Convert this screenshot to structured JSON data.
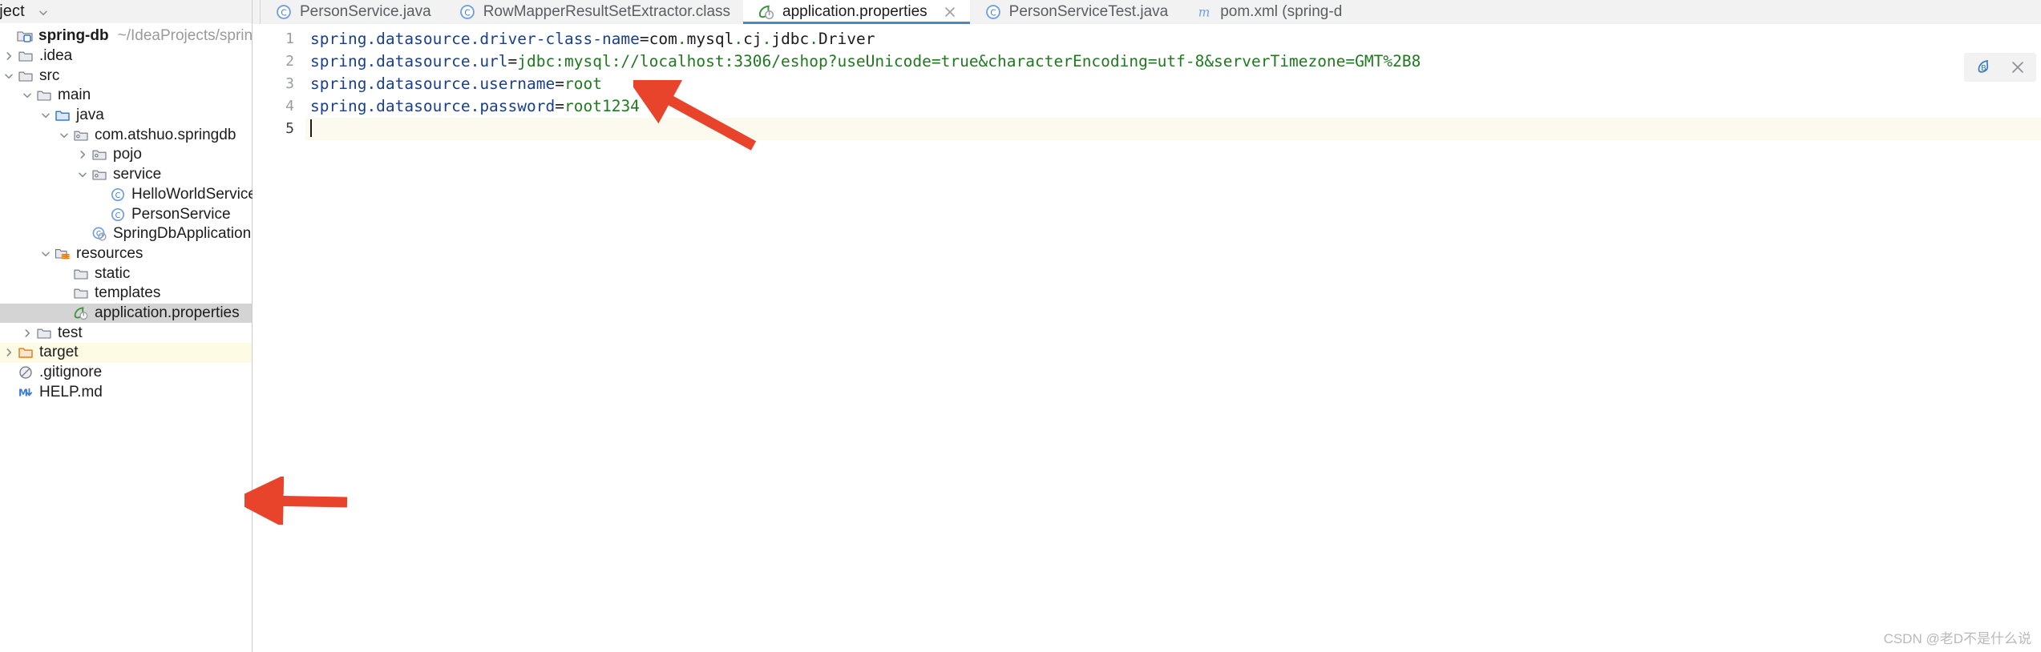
{
  "window": {
    "app": "IntelliJ IDEA",
    "watermark": "CSDN @老D不是什么说"
  },
  "project_panel": {
    "header_title": "oject",
    "header_chevron_icon": "chevron-down-icon",
    "tree": [
      {
        "label": "spring-db",
        "sublabel": "~/IdeaProjects/spring-db",
        "icon": "project-module-icon",
        "indent": 0,
        "twisty": "none",
        "bold": true,
        "state": "normal"
      },
      {
        "label": ".idea",
        "sublabel": "",
        "icon": "folder-icon",
        "indent": 1,
        "twisty": "collapsed",
        "bold": false,
        "state": "normal"
      },
      {
        "label": "src",
        "sublabel": "",
        "icon": "folder-icon",
        "indent": 1,
        "twisty": "expanded",
        "bold": false,
        "state": "normal"
      },
      {
        "label": "main",
        "sublabel": "",
        "icon": "folder-icon",
        "indent": 2,
        "twisty": "expanded",
        "bold": false,
        "state": "normal"
      },
      {
        "label": "java",
        "sublabel": "",
        "icon": "source-root-folder-icon",
        "indent": 3,
        "twisty": "expanded",
        "bold": false,
        "state": "normal"
      },
      {
        "label": "com.atshuo.springdb",
        "sublabel": "",
        "icon": "package-icon",
        "indent": 4,
        "twisty": "expanded",
        "bold": false,
        "state": "normal"
      },
      {
        "label": "pojo",
        "sublabel": "",
        "icon": "package-icon",
        "indent": 5,
        "twisty": "collapsed",
        "bold": false,
        "state": "normal"
      },
      {
        "label": "service",
        "sublabel": "",
        "icon": "package-icon",
        "indent": 5,
        "twisty": "expanded",
        "bold": false,
        "state": "normal"
      },
      {
        "label": "HelloWorldService",
        "sublabel": "",
        "icon": "java-class-icon",
        "indent": 6,
        "twisty": "none",
        "bold": false,
        "state": "normal"
      },
      {
        "label": "PersonService",
        "sublabel": "",
        "icon": "java-class-icon",
        "indent": 6,
        "twisty": "none",
        "bold": false,
        "state": "normal"
      },
      {
        "label": "SpringDbApplication",
        "sublabel": "",
        "icon": "spring-boot-class-icon",
        "indent": 5,
        "twisty": "none",
        "bold": false,
        "state": "normal"
      },
      {
        "label": "resources",
        "sublabel": "",
        "icon": "resources-root-folder-icon",
        "indent": 3,
        "twisty": "expanded",
        "bold": false,
        "state": "normal"
      },
      {
        "label": "static",
        "sublabel": "",
        "icon": "folder-icon",
        "indent": 4,
        "twisty": "none",
        "bold": false,
        "state": "normal"
      },
      {
        "label": "templates",
        "sublabel": "",
        "icon": "folder-icon",
        "indent": 4,
        "twisty": "none",
        "bold": false,
        "state": "normal"
      },
      {
        "label": "application.properties",
        "sublabel": "",
        "icon": "spring-properties-icon",
        "indent": 4,
        "twisty": "none",
        "bold": false,
        "state": "selected"
      },
      {
        "label": "test",
        "sublabel": "",
        "icon": "folder-icon",
        "indent": 2,
        "twisty": "collapsed",
        "bold": false,
        "state": "normal"
      },
      {
        "label": "target",
        "sublabel": "",
        "icon": "excluded-folder-icon",
        "indent": 1,
        "twisty": "collapsed",
        "bold": false,
        "state": "excluded"
      },
      {
        "label": ".gitignore",
        "sublabel": "",
        "icon": "gitignore-icon",
        "indent": 1,
        "twisty": "none",
        "bold": false,
        "state": "normal"
      },
      {
        "label": "HELP.md",
        "sublabel": "",
        "icon": "markdown-icon",
        "indent": 1,
        "twisty": "none",
        "bold": false,
        "state": "normal"
      }
    ]
  },
  "editor": {
    "tabs": [
      {
        "label": "PersonService.java",
        "icon": "java-class-icon",
        "active": false,
        "closable": false
      },
      {
        "label": "RowMapperResultSetExtractor.class",
        "icon": "java-class-icon",
        "active": false,
        "closable": false
      },
      {
        "label": "application.properties",
        "icon": "spring-properties-icon",
        "active": true,
        "closable": true,
        "close_icon": "close-icon"
      },
      {
        "label": "PersonServiceTest.java",
        "icon": "java-class-icon",
        "active": false,
        "closable": false
      },
      {
        "label": "pom.xml (spring-d",
        "icon": "maven-icon",
        "active": false,
        "closable": false
      }
    ],
    "line_numbers": [
      "1",
      "2",
      "3",
      "4",
      "5"
    ],
    "current_line": 5,
    "lines": [
      {
        "key": "spring.datasource.driver-class-name",
        "sep": "=",
        "value": "com.mysql.cj.jdbc.Driver",
        "value_style": "plain-dotted"
      },
      {
        "key": "spring.datasource.url",
        "sep": "=",
        "value": "jdbc:mysql://localhost:3306/eshop?useUnicode=true&characterEncoding=utf-8&serverTimezone=GMT%2B8",
        "value_style": "green"
      },
      {
        "key": "spring.datasource.username",
        "sep": "=",
        "value": "root",
        "value_style": "green"
      },
      {
        "key": "spring.datasource.password",
        "sep": "=",
        "value": "root1234",
        "value_style": "green"
      },
      {
        "key": "",
        "sep": "",
        "value": "",
        "value_style": "empty"
      }
    ],
    "float_toolbar": [
      {
        "icon": "spring-bean-icon",
        "name": "spring-inspection-icon"
      },
      {
        "icon": "close-icon",
        "name": "close-hint-icon"
      }
    ]
  },
  "annotations": {
    "arrow_editor_label": "",
    "arrow_tree_label": ""
  },
  "colors": {
    "tab_active_underline": "#4a86c8",
    "selection_gray": "#d4d4d4",
    "excluded_yellow": "#fdfbe4",
    "key_blue": "#1a3f8f",
    "value_green": "#1f7a1f",
    "arrow_red": "#e8442c",
    "spring_green": "#6db33f"
  }
}
